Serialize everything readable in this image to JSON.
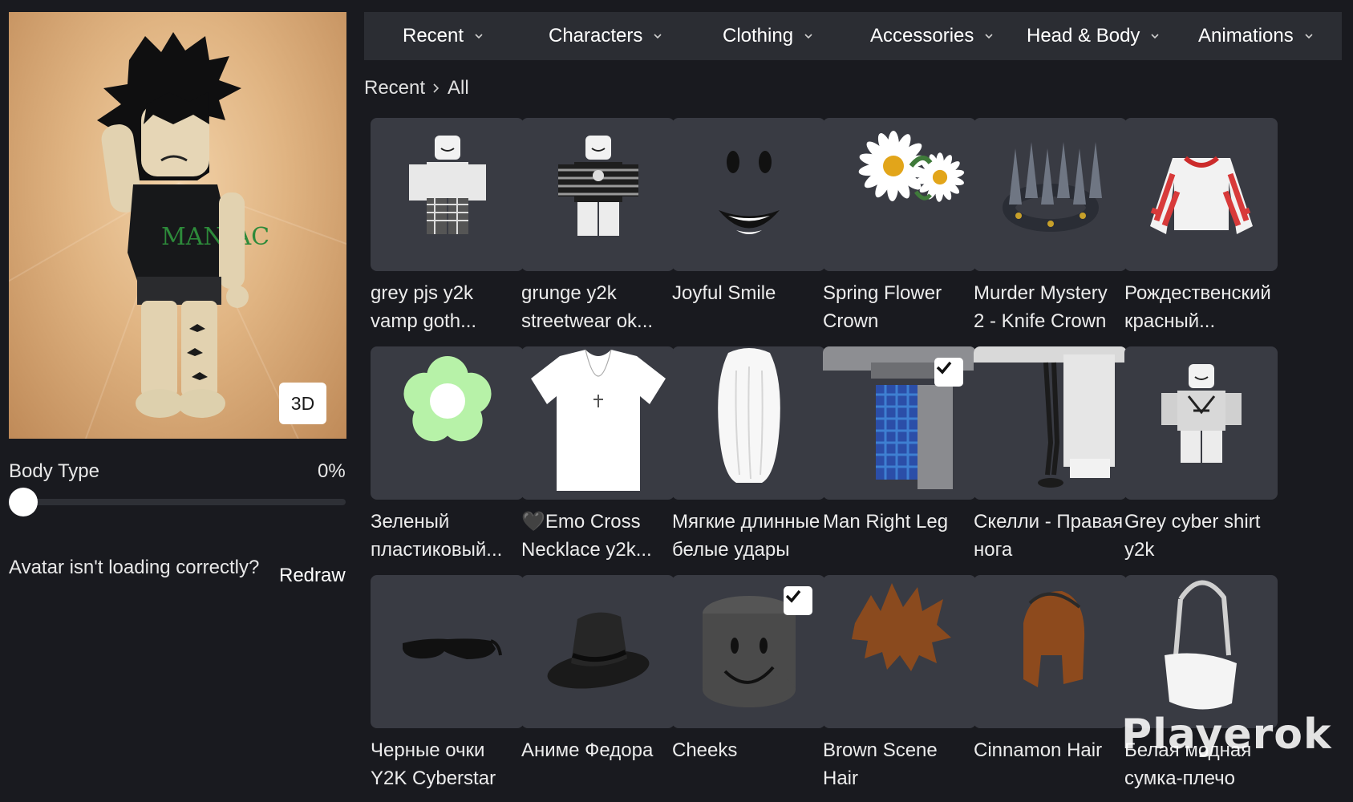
{
  "avatar": {
    "view_mode_button": "3D"
  },
  "body_type": {
    "label": "Body Type",
    "value_text": "0%",
    "value": 0
  },
  "loading": {
    "question": "Avatar isn't loading correctly?",
    "redraw": "Redraw"
  },
  "nav": [
    {
      "label": "Recent"
    },
    {
      "label": "Characters"
    },
    {
      "label": "Clothing"
    },
    {
      "label": "Accessories"
    },
    {
      "label": "Head & Body"
    },
    {
      "label": "Animations"
    }
  ],
  "breadcrumb": {
    "root": "Recent",
    "current": "All"
  },
  "items": [
    {
      "line1": "grey pjs y2k",
      "line2": "vamp goth...",
      "icon": "avatar-pjs-icon",
      "selected": false
    },
    {
      "line1": "grunge y2k",
      "line2": "streetwear ok...",
      "icon": "avatar-grunge-icon",
      "selected": false
    },
    {
      "line1": "Joyful Smile",
      "line2": "",
      "icon": "smile-face-icon",
      "selected": false
    },
    {
      "line1": "Spring Flower",
      "line2": "Crown",
      "icon": "daisy-crown-icon",
      "selected": false
    },
    {
      "line1": "Murder Mystery",
      "line2": "2 - Knife Crown",
      "icon": "knife-crown-icon",
      "selected": false
    },
    {
      "line1": "Рождественский",
      "line2": "красный...",
      "icon": "striped-sweater-icon",
      "selected": false
    },
    {
      "line1": "Зеленый",
      "line2": "пластиковый...",
      "icon": "green-flower-icon",
      "selected": false
    },
    {
      "line1": "🖤Emo Cross",
      "line2": "Necklace y2k...",
      "icon": "tshirt-cross-icon",
      "selected": false
    },
    {
      "line1": "Мягкие длинные",
      "line2": "белые удары",
      "icon": "white-hair-icon",
      "selected": false
    },
    {
      "line1": "Man Right Leg",
      "line2": "",
      "icon": "right-leg-icon",
      "selected": true
    },
    {
      "line1": "Скелли - Правая",
      "line2": "нога",
      "icon": "skeleton-leg-icon",
      "selected": false
    },
    {
      "line1": "Grey cyber shirt",
      "line2": "y2k",
      "icon": "avatar-cyber-icon",
      "selected": false
    },
    {
      "line1": "Черные очки",
      "line2": "Y2K Cyberstar",
      "icon": "sunglasses-icon",
      "selected": false
    },
    {
      "line1": "Аниме Федора",
      "line2": "",
      "icon": "fedora-icon",
      "selected": false
    },
    {
      "line1": "Cheeks",
      "line2": "",
      "icon": "cheeks-head-icon",
      "selected": true
    },
    {
      "line1": "Brown Scene",
      "line2": "Hair",
      "icon": "brown-hair-icon",
      "selected": false
    },
    {
      "line1": "Cinnamon Hair",
      "line2": "",
      "icon": "cinnamon-hair-icon",
      "selected": false
    },
    {
      "line1": "Белая модная",
      "line2": "сумка-плечо",
      "icon": "white-bag-icon",
      "selected": false
    }
  ],
  "watermark": "Playerok",
  "colors": {
    "background": "#191a1f",
    "card": "#393b43",
    "nav": "#2b2d33",
    "avatar_bg": "#e0b482"
  }
}
